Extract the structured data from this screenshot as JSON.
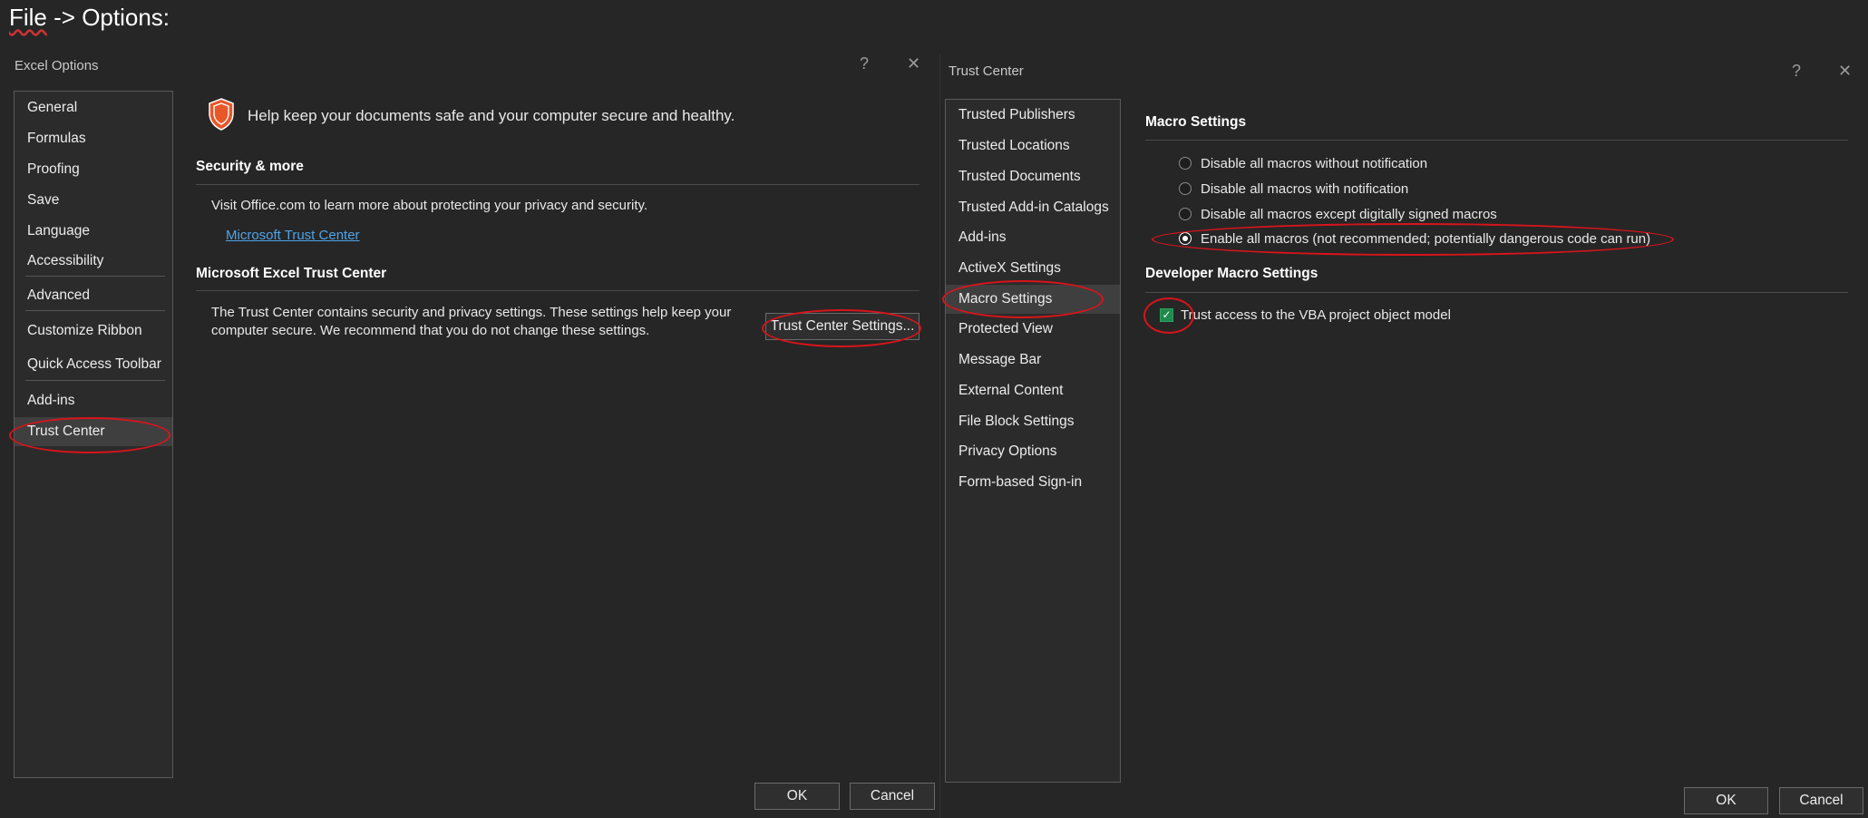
{
  "caption": {
    "prefix": "File",
    "rest": " -> Options:"
  },
  "excel_options": {
    "title": "Excel Options",
    "help": "?",
    "close": "✕",
    "sidebar": [
      "General",
      "Formulas",
      "Proofing",
      "Save",
      "Language",
      "Accessibility",
      "Advanced",
      "Customize Ribbon",
      "Quick Access Toolbar",
      "Add-ins",
      "Trust Center"
    ],
    "selected": "Trust Center",
    "headline": "Help keep your documents safe and your computer secure and healthy.",
    "section1_title": "Security & more",
    "section1_text": "Visit Office.com to learn more about protecting your privacy and security.",
    "section1_link": "Microsoft Trust Center",
    "section2_title": "Microsoft Excel Trust Center",
    "section2_text_line1": "The Trust Center contains security and privacy settings. These settings help keep your",
    "section2_text_line2": "computer secure. We recommend that you do not change these settings.",
    "trust_center_button": "Trust Center Settings...",
    "ok": "OK",
    "cancel": "Cancel"
  },
  "trust_center": {
    "title": "Trust Center",
    "help": "?",
    "close": "✕",
    "sidebar": [
      "Trusted Publishers",
      "Trusted Locations",
      "Trusted Documents",
      "Trusted Add-in Catalogs",
      "Add-ins",
      "ActiveX Settings",
      "Macro Settings",
      "Protected View",
      "Message Bar",
      "External Content",
      "File Block Settings",
      "Privacy Options",
      "Form-based Sign-in"
    ],
    "selected": "Macro Settings",
    "macro_title": "Macro Settings",
    "macro_options": [
      "Disable all macros without notification",
      "Disable all macros with notification",
      "Disable all macros except digitally signed macros",
      "Enable all macros (not recommended; potentially dangerous code can run)"
    ],
    "macro_selected_index": 3,
    "dev_title": "Developer Macro Settings",
    "vba_label": "Trust access to the VBA project object model",
    "vba_checked": true,
    "ok": "OK",
    "cancel": "Cancel"
  },
  "colors": {
    "background": "#262626",
    "annotation": "#d8141b",
    "shield": "#e8572a",
    "link": "#4fa3e8",
    "check": "#1f8a4c"
  }
}
